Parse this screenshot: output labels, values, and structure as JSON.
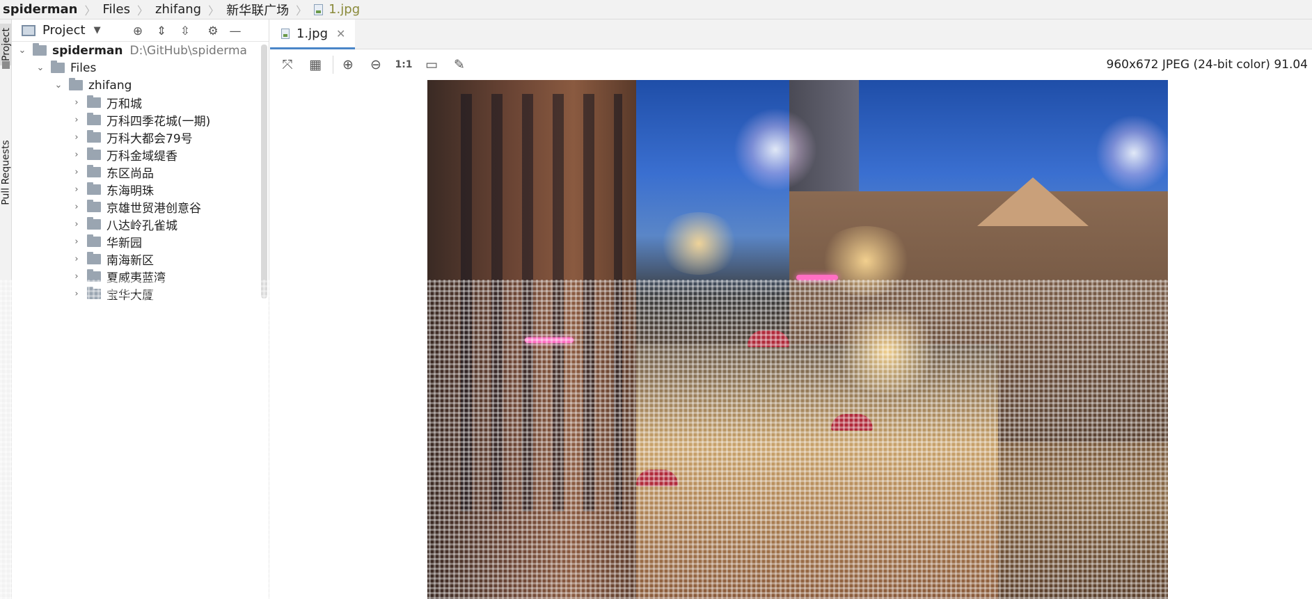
{
  "breadcrumb": {
    "items": [
      "spiderman",
      "Files",
      "zhifang",
      "新华联广场",
      "1.jpg"
    ]
  },
  "tool_strip": {
    "project_tab": "Project",
    "pull_requests_tab": "Pull Requests"
  },
  "project_panel": {
    "title": "Project",
    "tree": {
      "root": {
        "label": "spiderman",
        "path": "D:\\GitHub\\spiderma"
      },
      "files": "Files",
      "zhifang": "zhifang",
      "folders": [
        "万和城",
        "万科四季花城(一期)",
        "万科大都会79号",
        "万科金域缇香",
        "东区尚品",
        "东海明珠",
        "京雄世贸港创意谷",
        "八达岭孔雀城",
        "华新园",
        "南海新区",
        "夏威夷蓝湾",
        "宝华大厦"
      ]
    }
  },
  "editor": {
    "tab_label": "1.jpg"
  },
  "viewer": {
    "zoom_actual_label": "1:1",
    "image_info": "960x672 JPEG (24-bit color) 91.04"
  },
  "colors": {
    "accent": "#4a86c8",
    "folder": "#9aa5b1",
    "file_crumb": "#8a8a3a"
  }
}
